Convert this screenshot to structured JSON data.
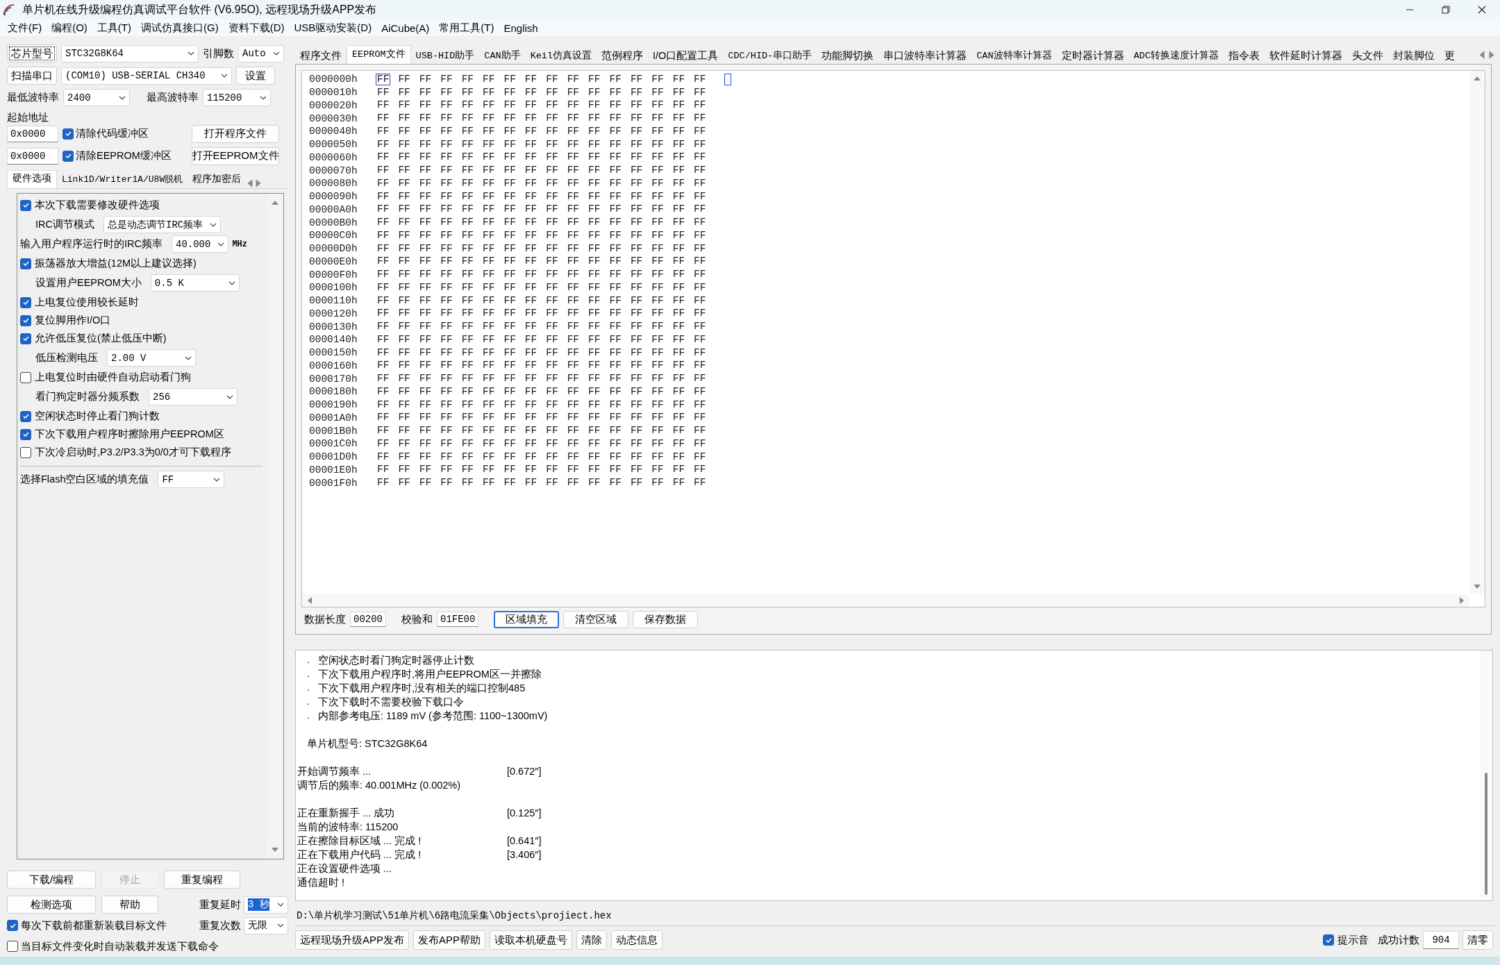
{
  "window": {
    "title": "单片机在线升级编程仿真调试平台软件 (V6.95O), 远程现场升级APP发布"
  },
  "menu": [
    {
      "label": "文件(F)"
    },
    {
      "label": "编程(O)"
    },
    {
      "label": "工具(T)"
    },
    {
      "label": "调试仿真接口(G)"
    },
    {
      "label": "资料下载(D)"
    },
    {
      "label": "USB驱动安装(D)"
    },
    {
      "label": "AiCube(A)"
    },
    {
      "label": "常用工具(T)"
    },
    {
      "label": "English"
    }
  ],
  "chip": {
    "button": "芯片型号",
    "model": "STC32G8K64",
    "pins_label": "引脚数",
    "pins": "Auto"
  },
  "port": {
    "button": "扫描串口",
    "value": "(COM10) USB-SERIAL CH340",
    "settings": "设置"
  },
  "baud": {
    "min_label": "最低波特率",
    "min": "2400",
    "max_label": "最高波特率",
    "max": "115200"
  },
  "start_address": {
    "label": "起始地址",
    "rows": [
      {
        "address": "0x0000",
        "checkbox": "清除代码缓冲区",
        "checked": true,
        "button": "打开程序文件"
      },
      {
        "address": "0x0000",
        "checkbox": "清除EEPROM缓冲区",
        "checked": true,
        "button": "打开EEPROM文件"
      }
    ]
  },
  "option_tabs": [
    {
      "label": "硬件选项",
      "selected": true
    },
    {
      "label": "Link1D/Writer1A/U8W脱机",
      "selected": false
    },
    {
      "label": "程序加密后",
      "selected": false
    }
  ],
  "options": [
    {
      "kind": "checkbox",
      "label": "本次下载需要修改硬件选项",
      "checked": true
    },
    {
      "kind": "select",
      "label": "IRC调节模式",
      "value": "总是动态调节IRC频率",
      "indent": true
    },
    {
      "kind": "select",
      "label": "输入用户程序运行时的IRC频率",
      "value": "40.000",
      "unit": "MHz",
      "indent": false
    },
    {
      "kind": "checkbox",
      "label": "振荡器放大增益(12M以上建议选择)",
      "checked": true
    },
    {
      "kind": "select",
      "label": "设置用户EEPROM大小",
      "value": "0.5 K",
      "indent": true
    },
    {
      "kind": "checkbox",
      "label": "上电复位使用较长延时",
      "checked": true
    },
    {
      "kind": "checkbox",
      "label": "复位脚用作I/O口",
      "checked": true
    },
    {
      "kind": "checkbox",
      "label": "允许低压复位(禁止低压中断)",
      "checked": true
    },
    {
      "kind": "select",
      "label": "低压检测电压",
      "value": "2.00 V",
      "indent": true
    },
    {
      "kind": "checkbox",
      "label": "上电复位时由硬件自动启动看门狗",
      "checked": false
    },
    {
      "kind": "select",
      "label": "看门狗定时器分频系数",
      "value": "256",
      "indent": true
    },
    {
      "kind": "checkbox",
      "label": "空闲状态时停止看门狗计数",
      "checked": true
    },
    {
      "kind": "checkbox",
      "label": "下次下载用户程序时擦除用户EEPROM区",
      "checked": true
    },
    {
      "kind": "checkbox",
      "label": "下次冷启动时,P3.2/P3.3为0/0才可下载程序",
      "checked": false
    },
    {
      "kind": "divider"
    },
    {
      "kind": "select",
      "label": "选择Flash空白区域的填充值",
      "value": "FF",
      "indent": false
    }
  ],
  "actions": [
    {
      "label": "下载/编程",
      "disabled": false
    },
    {
      "label": "停止",
      "disabled": true
    },
    {
      "label": "重复编程",
      "disabled": false
    },
    {
      "label": "检测选项",
      "disabled": false
    },
    {
      "label": "帮助",
      "disabled": false
    }
  ],
  "repeat": {
    "delay_label": "重复延时",
    "delay": "3 秒",
    "delay_highlighted": true,
    "count_label": "重复次数",
    "count": "无限"
  },
  "auto_options": [
    {
      "label": "每次下载前都重新装载目标文件",
      "checked": true
    },
    {
      "label": "当目标文件变化时自动装载并发送下载命令",
      "checked": false
    }
  ],
  "tabs": [
    {
      "label": "程序文件",
      "selected": false
    },
    {
      "label": "EEPROM文件",
      "selected": true
    },
    {
      "label": "USB-HID助手",
      "selected": false
    },
    {
      "label": "CAN助手",
      "selected": false
    },
    {
      "label": "Keil仿真设置",
      "selected": false
    },
    {
      "label": "范例程序",
      "selected": false
    },
    {
      "label": "I/O口配置工具",
      "selected": false
    },
    {
      "label": "CDC/HID-串口助手",
      "selected": false
    },
    {
      "label": "功能脚切换",
      "selected": false
    },
    {
      "label": "串口波特率计算器",
      "selected": false
    },
    {
      "label": "CAN波特率计算器",
      "selected": false
    },
    {
      "label": "定时器计算器",
      "selected": false
    },
    {
      "label": "ADC转换速度计算器",
      "selected": false
    },
    {
      "label": "指令表",
      "selected": false
    },
    {
      "label": "软件延时计算器",
      "selected": false
    },
    {
      "label": "头文件",
      "selected": false
    },
    {
      "label": "封装脚位",
      "selected": false
    },
    {
      "label": "更",
      "selected": false
    }
  ],
  "hex": {
    "rows": [
      {
        "address": "0000000h",
        "bytes": "FF FF FF FF FF FF FF FF FF FF FF FF FF FF FF FF",
        "cursor": true
      },
      {
        "address": "0000010h",
        "bytes": "FF FF FF FF FF FF FF FF FF FF FF FF FF FF FF FF",
        "cursor": false
      },
      {
        "address": "0000020h",
        "bytes": "FF FF FF FF FF FF FF FF FF FF FF FF FF FF FF FF",
        "cursor": false
      },
      {
        "address": "0000030h",
        "bytes": "FF FF FF FF FF FF FF FF FF FF FF FF FF FF FF FF",
        "cursor": false
      },
      {
        "address": "0000040h",
        "bytes": "FF FF FF FF FF FF FF FF FF FF FF FF FF FF FF FF",
        "cursor": false
      },
      {
        "address": "0000050h",
        "bytes": "FF FF FF FF FF FF FF FF FF FF FF FF FF FF FF FF",
        "cursor": false
      },
      {
        "address": "0000060h",
        "bytes": "FF FF FF FF FF FF FF FF FF FF FF FF FF FF FF FF",
        "cursor": false
      },
      {
        "address": "0000070h",
        "bytes": "FF FF FF FF FF FF FF FF FF FF FF FF FF FF FF FF",
        "cursor": false
      },
      {
        "address": "0000080h",
        "bytes": "FF FF FF FF FF FF FF FF FF FF FF FF FF FF FF FF",
        "cursor": false
      },
      {
        "address": "0000090h",
        "bytes": "FF FF FF FF FF FF FF FF FF FF FF FF FF FF FF FF",
        "cursor": false
      },
      {
        "address": "00000A0h",
        "bytes": "FF FF FF FF FF FF FF FF FF FF FF FF FF FF FF FF",
        "cursor": false
      },
      {
        "address": "00000B0h",
        "bytes": "FF FF FF FF FF FF FF FF FF FF FF FF FF FF FF FF",
        "cursor": false
      },
      {
        "address": "00000C0h",
        "bytes": "FF FF FF FF FF FF FF FF FF FF FF FF FF FF FF FF",
        "cursor": false
      },
      {
        "address": "00000D0h",
        "bytes": "FF FF FF FF FF FF FF FF FF FF FF FF FF FF FF FF",
        "cursor": false
      },
      {
        "address": "00000E0h",
        "bytes": "FF FF FF FF FF FF FF FF FF FF FF FF FF FF FF FF",
        "cursor": false
      },
      {
        "address": "00000F0h",
        "bytes": "FF FF FF FF FF FF FF FF FF FF FF FF FF FF FF FF",
        "cursor": false
      },
      {
        "address": "0000100h",
        "bytes": "FF FF FF FF FF FF FF FF FF FF FF FF FF FF FF FF",
        "cursor": false
      },
      {
        "address": "0000110h",
        "bytes": "FF FF FF FF FF FF FF FF FF FF FF FF FF FF FF FF",
        "cursor": false
      },
      {
        "address": "0000120h",
        "bytes": "FF FF FF FF FF FF FF FF FF FF FF FF FF FF FF FF",
        "cursor": false
      },
      {
        "address": "0000130h",
        "bytes": "FF FF FF FF FF FF FF FF FF FF FF FF FF FF FF FF",
        "cursor": false
      },
      {
        "address": "0000140h",
        "bytes": "FF FF FF FF FF FF FF FF FF FF FF FF FF FF FF FF",
        "cursor": false
      },
      {
        "address": "0000150h",
        "bytes": "FF FF FF FF FF FF FF FF FF FF FF FF FF FF FF FF",
        "cursor": false
      },
      {
        "address": "0000160h",
        "bytes": "FF FF FF FF FF FF FF FF FF FF FF FF FF FF FF FF",
        "cursor": false
      },
      {
        "address": "0000170h",
        "bytes": "FF FF FF FF FF FF FF FF FF FF FF FF FF FF FF FF",
        "cursor": false
      },
      {
        "address": "0000180h",
        "bytes": "FF FF FF FF FF FF FF FF FF FF FF FF FF FF FF FF",
        "cursor": false
      },
      {
        "address": "0000190h",
        "bytes": "FF FF FF FF FF FF FF FF FF FF FF FF FF FF FF FF",
        "cursor": false
      },
      {
        "address": "00001A0h",
        "bytes": "FF FF FF FF FF FF FF FF FF FF FF FF FF FF FF FF",
        "cursor": false
      },
      {
        "address": "00001B0h",
        "bytes": "FF FF FF FF FF FF FF FF FF FF FF FF FF FF FF FF",
        "cursor": false
      },
      {
        "address": "00001C0h",
        "bytes": "FF FF FF FF FF FF FF FF FF FF FF FF FF FF FF FF",
        "cursor": false
      },
      {
        "address": "00001D0h",
        "bytes": "FF FF FF FF FF FF FF FF FF FF FF FF FF FF FF FF",
        "cursor": false
      },
      {
        "address": "00001E0h",
        "bytes": "FF FF FF FF FF FF FF FF FF FF FF FF FF FF FF FF",
        "cursor": false
      },
      {
        "address": "00001F0h",
        "bytes": "FF FF FF FF FF FF FF FF FF FF FF FF FF FF FF FF",
        "cursor": false
      }
    ],
    "length_label": "数据长度",
    "length": "00200",
    "checksum_label": "校验和",
    "checksum": "01FE00",
    "buttons": [
      {
        "label": "区域填充",
        "focused": true
      },
      {
        "label": "清空区域",
        "focused": false
      },
      {
        "label": "保存数据",
        "focused": false
      }
    ]
  },
  "log": [
    {
      "kind": "bullet",
      "mark": ".",
      "text": "空闲状态时看门狗定时器停止计数"
    },
    {
      "kind": "bullet",
      "mark": ".",
      "text": "下次下载用户程序时,将用户EEPROM区一并擦除"
    },
    {
      "kind": "bullet",
      "mark": ".",
      "text": "下次下载用户程序时,没有相关的端口控制485"
    },
    {
      "kind": "bullet",
      "mark": ".",
      "text": "下次下载时不需要校验下载口令"
    },
    {
      "kind": "bullet",
      "mark": ".",
      "text": "内部参考电压: 1189 mV (参考范围: 1100~1300mV)"
    },
    {
      "kind": "blank"
    },
    {
      "kind": "indent",
      "text": "单片机型号: STC32G8K64"
    },
    {
      "kind": "blank"
    },
    {
      "kind": "plain",
      "text": "开始调节频率 ...",
      "time": "[0.672″]"
    },
    {
      "kind": "plain",
      "text": "调节后的频率: 40.001MHz (0.002%)"
    },
    {
      "kind": "blank"
    },
    {
      "kind": "plain",
      "text": "正在重新握手 ... 成功",
      "time": "[0.125″]"
    },
    {
      "kind": "plain",
      "text": "当前的波特率: 115200"
    },
    {
      "kind": "plain",
      "text": "正在擦除目标区域 ... 完成 !",
      "time": "[0.641″]"
    },
    {
      "kind": "plain",
      "text": "正在下载用户代码 ... 完成 !",
      "time": "[3.406″]"
    },
    {
      "kind": "plain",
      "text": "正在设置硬件选项 ..."
    },
    {
      "kind": "plain",
      "text": "通信超时 !"
    }
  ],
  "file_path": "D:\\单片机学习测试\\51单片机\\6路电流采集\\Objects\\projiect.hex",
  "bottom_buttons": [
    {
      "label": "远程现场升级APP发布"
    },
    {
      "label": "发布APP帮助"
    },
    {
      "label": "读取本机硬盘号"
    },
    {
      "label": "清除"
    },
    {
      "label": "动态信息"
    }
  ],
  "sound": {
    "label": "提示音",
    "checked": true
  },
  "success": {
    "label": "成功计数",
    "count": "904",
    "reset": "清零"
  }
}
